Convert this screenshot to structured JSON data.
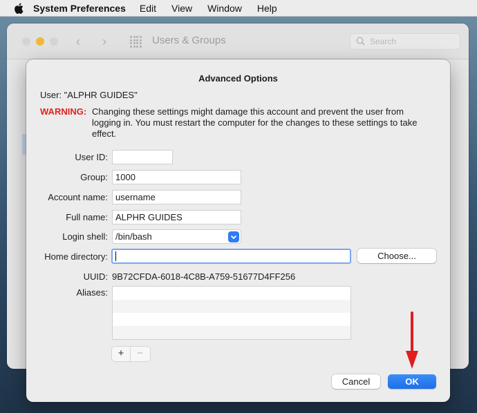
{
  "menubar": {
    "app_name": "System Preferences",
    "items": [
      "Edit",
      "View",
      "Window",
      "Help"
    ]
  },
  "background_window": {
    "title": "Users & Groups",
    "search_placeholder": "Search"
  },
  "dialog": {
    "title": "Advanced Options",
    "user_line": "User:  \"ALPHR GUIDES\"",
    "warning_label": "WARNING:",
    "warning_text": "Changing these settings might damage this account and prevent the user from logging in. You must restart the computer for the changes to these settings to take effect.",
    "fields": {
      "user_id_label": "User ID:",
      "user_id_value": "",
      "group_label": "Group:",
      "group_value": "1000",
      "account_name_label": "Account name:",
      "account_name_value": "username",
      "full_name_label": "Full name:",
      "full_name_value": "ALPHR GUIDES",
      "login_shell_label": "Login shell:",
      "login_shell_value": "/bin/bash",
      "home_directory_label": "Home directory:",
      "home_directory_value": "",
      "uuid_label": "UUID:",
      "uuid_value": "9B72CFDA-6018-4C8B-A759-51677D4FF256",
      "aliases_label": "Aliases:"
    },
    "choose_button": "Choose...",
    "add_symbol": "+",
    "remove_symbol": "−",
    "cancel_button": "Cancel",
    "ok_button": "OK"
  },
  "colors": {
    "warning": "#e0241b",
    "accent": "#2f7bf5",
    "annotation_arrow": "#e11d1d"
  }
}
